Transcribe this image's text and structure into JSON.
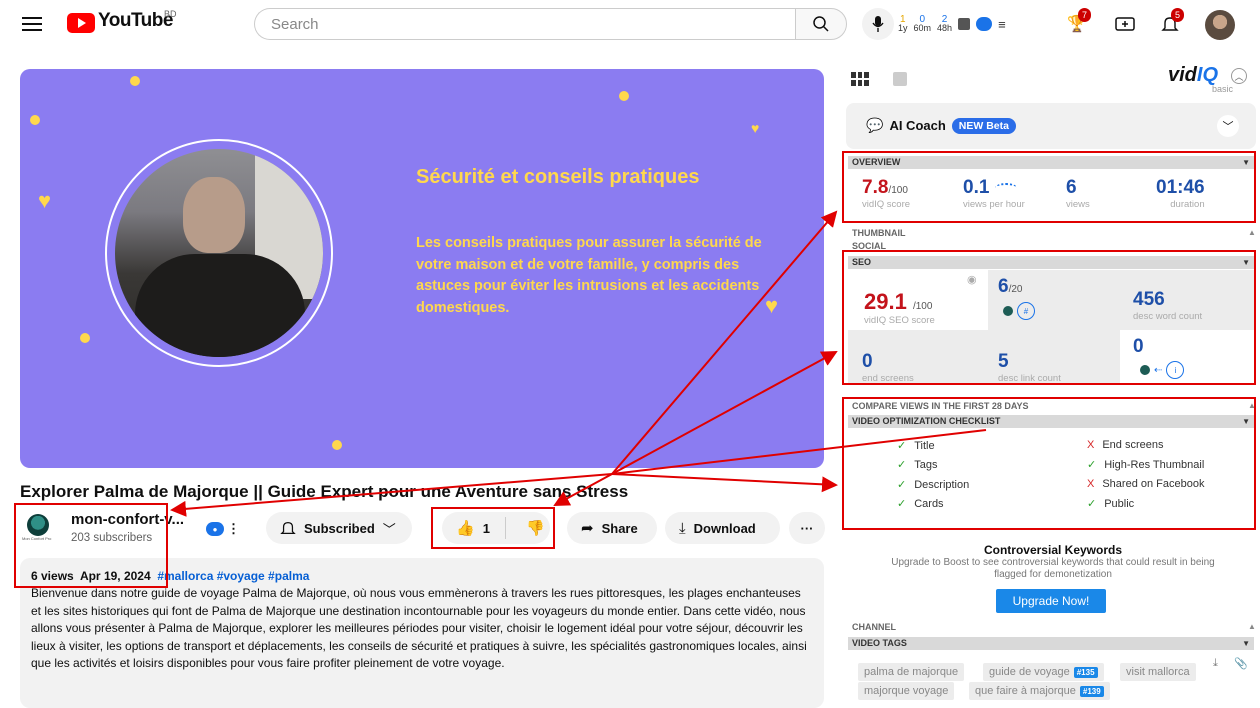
{
  "header": {
    "logo_text": "YouTube",
    "country_code": "BD",
    "search_placeholder": "Search",
    "vidiq_stats": [
      {
        "value": "1",
        "label": "1y"
      },
      {
        "value": "0",
        "label": "60m"
      },
      {
        "value": "2",
        "label": "48h"
      }
    ],
    "notification_count": "5",
    "achievement_count": "7"
  },
  "video": {
    "slide_title": "Sécurité et conseils pratiques",
    "slide_text": "Les conseils pratiques pour assurer la sécurité de votre maison et de votre famille, y compris des astuces pour éviter les intrusions et les accidents domestiques.",
    "title": "Explorer Palma de Majorque || Guide Expert pour une Aventure sans Stress"
  },
  "channel": {
    "name": "mon-confort-v...",
    "subscribers": "203 subscribers",
    "avatar_caption": "Mon Confort Pro"
  },
  "actions": {
    "subscribed_label": "Subscribed",
    "like_count": "1",
    "share_label": "Share",
    "download_label": "Download",
    "more_label": "···"
  },
  "description": {
    "views": "6 views",
    "date": "Apr 19, 2024",
    "hashtags": "#mallorca #voyage #palma",
    "text": "Bienvenue dans notre guide de voyage Palma de Majorque, où nous vous emmènerons à travers les rues pittoresques, les plages enchanteuses et les sites historiques qui font de Palma de Majorque une destination incontournable pour les voyageurs du monde entier. Dans cette vidéo, nous allons vous présenter à Palma de Majorque, explorer les meilleures périodes pour visiter, choisir le logement idéal pour votre séjour, découvrir les lieux à visiter, les options de transport et déplacements, les conseils de sécurité et pratiques à suivre, les spécialités gastronomiques locales, ainsi que les activités et loisirs disponibles pour vous faire profiter pleinement de votre voyage."
  },
  "vidiq": {
    "logo_main": "vid",
    "logo_iq": "IQ",
    "plan": "basic",
    "ai_coach_label": "AI Coach",
    "ai_coach_badge": "NEW Beta",
    "overview": {
      "heading": "OVERVIEW",
      "score": "7.8",
      "score_max": "/100",
      "score_label": "vidIQ score",
      "vph": "0.1",
      "vph_label": "views per hour",
      "views": "6",
      "views_label": "views",
      "duration": "01:46",
      "duration_label": "duration"
    },
    "collapsed_sections": [
      "THUMBNAIL",
      "SOCIAL"
    ],
    "seo": {
      "heading": "SEO",
      "score": "29.1",
      "score_max": "/100",
      "score_label": "vidIQ SEO score",
      "tags_count": "6",
      "tags_max": "/20",
      "word_count": "456",
      "word_count_label": "desc word count",
      "end_screens": "0",
      "end_screens_label": "end screens",
      "link_count": "5",
      "link_count_label": "desc link count",
      "cards": "0"
    },
    "compare_heading": "COMPARE VIEWS IN THE FIRST 28 DAYS",
    "checklist_heading": "VIDEO OPTIMIZATION CHECKLIST",
    "checklist": [
      {
        "label": "Title",
        "ok": true
      },
      {
        "label": "End screens",
        "ok": false
      },
      {
        "label": "Tags",
        "ok": true
      },
      {
        "label": "High-Res Thumbnail",
        "ok": true
      },
      {
        "label": "Description",
        "ok": true
      },
      {
        "label": "Shared on Facebook",
        "ok": false
      },
      {
        "label": "Cards",
        "ok": true
      },
      {
        "label": "Public",
        "ok": true
      }
    ],
    "check_mark": "✓",
    "cross_mark": "X",
    "keywords_title": "Controversial Keywords",
    "keywords_sub": "Upgrade to Boost to see controversial keywords that could result in being flagged for demonetization",
    "upgrade_label": "Upgrade Now!",
    "channel_heading": "CHANNEL",
    "tags_heading": "VIDEO TAGS",
    "tags": [
      {
        "text": "palma de majorque",
        "rank": ""
      },
      {
        "text": "guide de voyage",
        "rank": "#135"
      },
      {
        "text": "visit mallorca",
        "rank": ""
      },
      {
        "text": "majorque voyage",
        "rank": ""
      },
      {
        "text": "que faire à majorque",
        "rank": "#139"
      }
    ]
  },
  "colors": {
    "annotation_red": "#e00000",
    "slide_bg": "#8b7cf1",
    "slide_accent": "#ffd84d",
    "vidiq_blue": "#1a73e8"
  }
}
